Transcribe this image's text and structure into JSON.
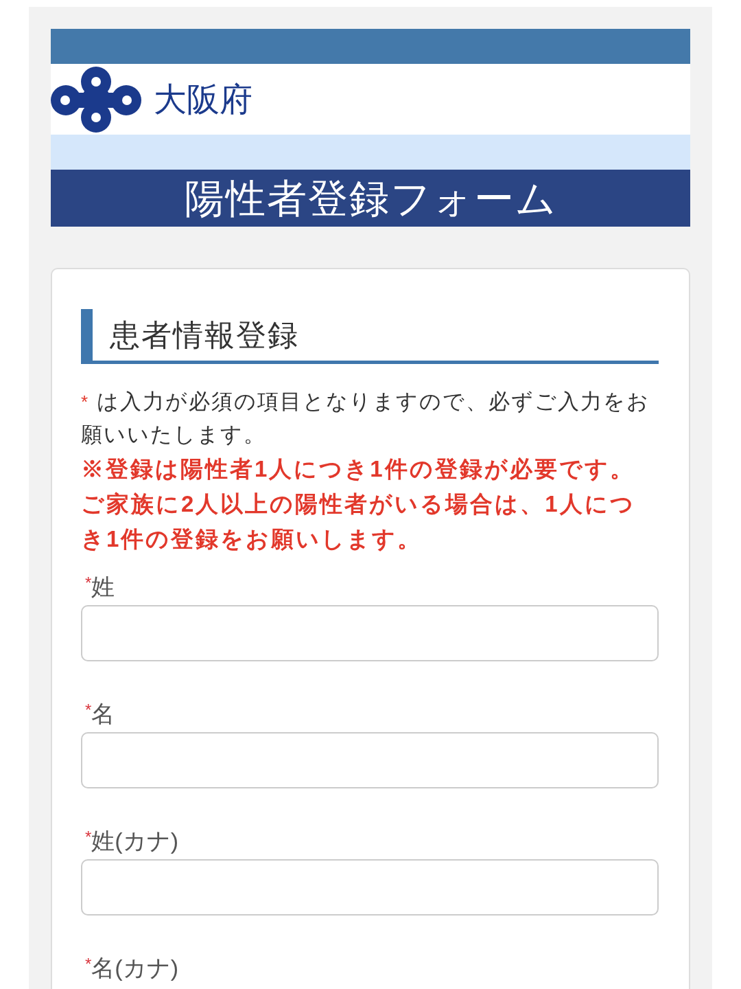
{
  "header": {
    "org_name": "大阪府",
    "title": "陽性者登録フォーム"
  },
  "form": {
    "section_title": "患者情報登録",
    "required_note": {
      "marker": "*",
      "text": "は入力が必須の項目となりますので、必ずご入力をお願いいたします。"
    },
    "notices": [
      "※登録は陽性者1人につき1件の登録が必要です。",
      "ご家族に2人以上の陽性者がいる場合は、1人につき1件の登録をお願いします。"
    ],
    "fields": [
      {
        "marker": "*",
        "label": "姓"
      },
      {
        "marker": "*",
        "label": "名"
      },
      {
        "marker": "*",
        "label": "姓(カナ)"
      },
      {
        "marker": "*",
        "label": "名(カナ)"
      }
    ]
  }
}
